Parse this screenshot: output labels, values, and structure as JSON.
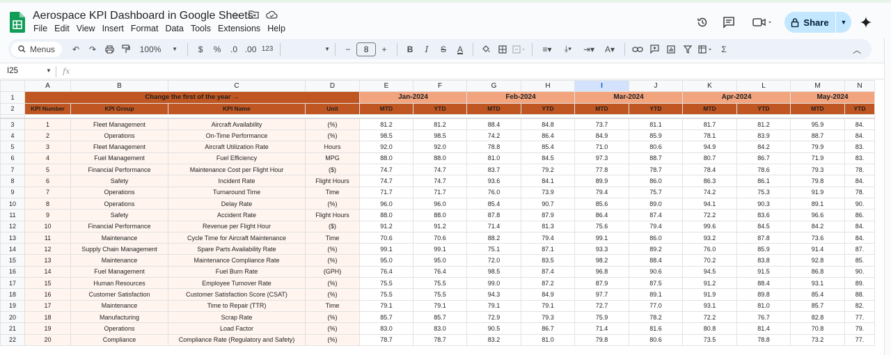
{
  "app": {
    "title": "Aerospace KPI Dashboard in Google Sheets",
    "menu": [
      "File",
      "Edit",
      "View",
      "Insert",
      "Format",
      "Data",
      "Tools",
      "Extensions",
      "Help"
    ],
    "share_label": "Share",
    "icons": {
      "star": "star-icon",
      "move": "folder-move-icon",
      "cloud": "cloud-saved-icon",
      "history": "history-icon",
      "comments": "comment-icon",
      "meet": "video-call-icon",
      "gemini": "gemini-sparkle-icon",
      "accent": "#c2e7ff"
    }
  },
  "toolbar": {
    "menus_label": "Menus",
    "zoom": "100%",
    "currency": "$",
    "percent": "%",
    "dec_decrease": ".0",
    "dec_increase": ".00",
    "number_format": "123",
    "font_size": "8"
  },
  "formula_bar": {
    "cell_ref": "I25",
    "fx": "fx"
  },
  "sheet": {
    "colors": {
      "header_dark": "#c05621",
      "month_band": "#f2a47f",
      "kpi_bg": "#fff4ee"
    },
    "column_letters": [
      "A",
      "B",
      "C",
      "D",
      "E",
      "F",
      "G",
      "H",
      "I",
      "J",
      "K",
      "L",
      "M",
      "N"
    ],
    "selected_column": "I",
    "banner": "Change the first of the year →",
    "months": [
      "Jan-2024",
      "Feb-2024",
      "Mar-2024",
      "Apr-2024",
      "May-2024"
    ],
    "header": {
      "kpi_number": "KPI Number",
      "kpi_group": "KPI Group",
      "kpi_name": "KPI Name",
      "unit": "Unit",
      "mtd": "MTD",
      "ytd": "YTD"
    },
    "rows": [
      {
        "num": "1",
        "group": "Fleet Management",
        "name": "Aircraft Availability",
        "unit": "(%)",
        "vals": [
          "81.2",
          "81.2",
          "88.4",
          "84.8",
          "73.7",
          "81.1",
          "81.7",
          "81.2",
          "95.9",
          "84."
        ]
      },
      {
        "num": "2",
        "group": "Operations",
        "name": "On-Time Performance",
        "unit": "(%)",
        "vals": [
          "98.5",
          "98.5",
          "74.2",
          "86.4",
          "84.9",
          "85.9",
          "78.1",
          "83.9",
          "88.7",
          "84."
        ]
      },
      {
        "num": "3",
        "group": "Fleet Management",
        "name": "Aircraft Utilization Rate",
        "unit": "Hours",
        "vals": [
          "92.0",
          "92.0",
          "78.8",
          "85.4",
          "71.0",
          "80.6",
          "94.9",
          "84.2",
          "79.9",
          "83."
        ]
      },
      {
        "num": "4",
        "group": "Fuel Management",
        "name": "Fuel Efficiency",
        "unit": "MPG",
        "vals": [
          "88.0",
          "88.0",
          "81.0",
          "84.5",
          "97.3",
          "88.7",
          "80.7",
          "86.7",
          "71.9",
          "83."
        ]
      },
      {
        "num": "5",
        "group": "Financial Performance",
        "name": "Maintenance Cost per Flight Hour",
        "unit": "($)",
        "vals": [
          "74.7",
          "74.7",
          "83.7",
          "79.2",
          "77.8",
          "78.7",
          "78.4",
          "78.6",
          "79.3",
          "78."
        ]
      },
      {
        "num": "6",
        "group": "Safety",
        "name": "Incident Rate",
        "unit": "Flight Hours",
        "vals": [
          "74.7",
          "74.7",
          "93.6",
          "84.1",
          "89.9",
          "86.0",
          "86.3",
          "86.1",
          "79.8",
          "84."
        ]
      },
      {
        "num": "7",
        "group": "Operations",
        "name": "Turnaround Time",
        "unit": "Time",
        "vals": [
          "71.7",
          "71.7",
          "76.0",
          "73.9",
          "79.4",
          "75.7",
          "74.2",
          "75.3",
          "91.9",
          "78."
        ]
      },
      {
        "num": "8",
        "group": "Operations",
        "name": "Delay Rate",
        "unit": "(%)",
        "vals": [
          "96.0",
          "96.0",
          "85.4",
          "90.7",
          "85.6",
          "89.0",
          "94.1",
          "90.3",
          "89.1",
          "90."
        ]
      },
      {
        "num": "9",
        "group": "Safety",
        "name": "Accident Rate",
        "unit": "Flight Hours",
        "vals": [
          "88.0",
          "88.0",
          "87.8",
          "87.9",
          "86.4",
          "87.4",
          "72.2",
          "83.6",
          "96.6",
          "86."
        ]
      },
      {
        "num": "10",
        "group": "Financial Performance",
        "name": "Revenue per Flight Hour",
        "unit": "($)",
        "vals": [
          "91.2",
          "91.2",
          "71.4",
          "81.3",
          "75.6",
          "79.4",
          "99.6",
          "84.5",
          "84.2",
          "84."
        ]
      },
      {
        "num": "11",
        "group": "Maintenance",
        "name": "Cycle Time for Aircraft Maintenance",
        "unit": "Time",
        "vals": [
          "70.6",
          "70.6",
          "88.2",
          "79.4",
          "99.1",
          "86.0",
          "93.2",
          "87.8",
          "73.6",
          "84."
        ]
      },
      {
        "num": "12",
        "group": "Supply Chain Management",
        "name": "Spare Parts Availability Rate",
        "unit": "(%)",
        "vals": [
          "99.1",
          "99.1",
          "75.1",
          "87.1",
          "93.3",
          "89.2",
          "76.0",
          "85.9",
          "91.4",
          "87."
        ]
      },
      {
        "num": "13",
        "group": "Maintenance",
        "name": "Maintenance Compliance Rate",
        "unit": "(%)",
        "vals": [
          "95.0",
          "95.0",
          "72.0",
          "83.5",
          "98.2",
          "88.4",
          "70.2",
          "83.8",
          "92.8",
          "85."
        ]
      },
      {
        "num": "14",
        "group": "Fuel Management",
        "name": "Fuel Burn Rate",
        "unit": "(GPH)",
        "vals": [
          "76.4",
          "76.4",
          "98.5",
          "87.4",
          "96.8",
          "90.6",
          "94.5",
          "91.5",
          "86.8",
          "90."
        ]
      },
      {
        "num": "15",
        "group": "Human Resources",
        "name": "Employee Turnover Rate",
        "unit": "(%)",
        "vals": [
          "75.5",
          "75.5",
          "99.0",
          "87.2",
          "87.9",
          "87.5",
          "91.2",
          "88.4",
          "93.1",
          "89."
        ]
      },
      {
        "num": "16",
        "group": "Customer Satisfaction",
        "name": "Customer Satisfaction Score (CSAT)",
        "unit": "(%)",
        "vals": [
          "75.5",
          "75.5",
          "94.3",
          "84.9",
          "97.7",
          "89.1",
          "91.9",
          "89.8",
          "85.4",
          "88."
        ]
      },
      {
        "num": "17",
        "group": "Maintenance",
        "name": "Time to Repair (TTR)",
        "unit": "Time",
        "vals": [
          "79.1",
          "79.1",
          "79.1",
          "79.1",
          "72.7",
          "77.0",
          "93.1",
          "81.0",
          "85.7",
          "82."
        ]
      },
      {
        "num": "18",
        "group": "Manufacturing",
        "name": "Scrap Rate",
        "unit": "(%)",
        "vals": [
          "85.7",
          "85.7",
          "72.9",
          "79.3",
          "75.9",
          "78.2",
          "72.2",
          "76.7",
          "82.8",
          "77."
        ]
      },
      {
        "num": "19",
        "group": "Operations",
        "name": "Load Factor",
        "unit": "(%)",
        "vals": [
          "83.0",
          "83.0",
          "90.5",
          "86.7",
          "71.4",
          "81.6",
          "80.8",
          "81.4",
          "70.8",
          "79."
        ]
      },
      {
        "num": "20",
        "group": "Compliance",
        "name": "Compliance Rate (Regulatory and Safety)",
        "unit": "(%)",
        "vals": [
          "78.7",
          "78.7",
          "83.2",
          "81.0",
          "79.8",
          "80.6",
          "73.5",
          "78.8",
          "73.2",
          "77."
        ]
      }
    ]
  }
}
